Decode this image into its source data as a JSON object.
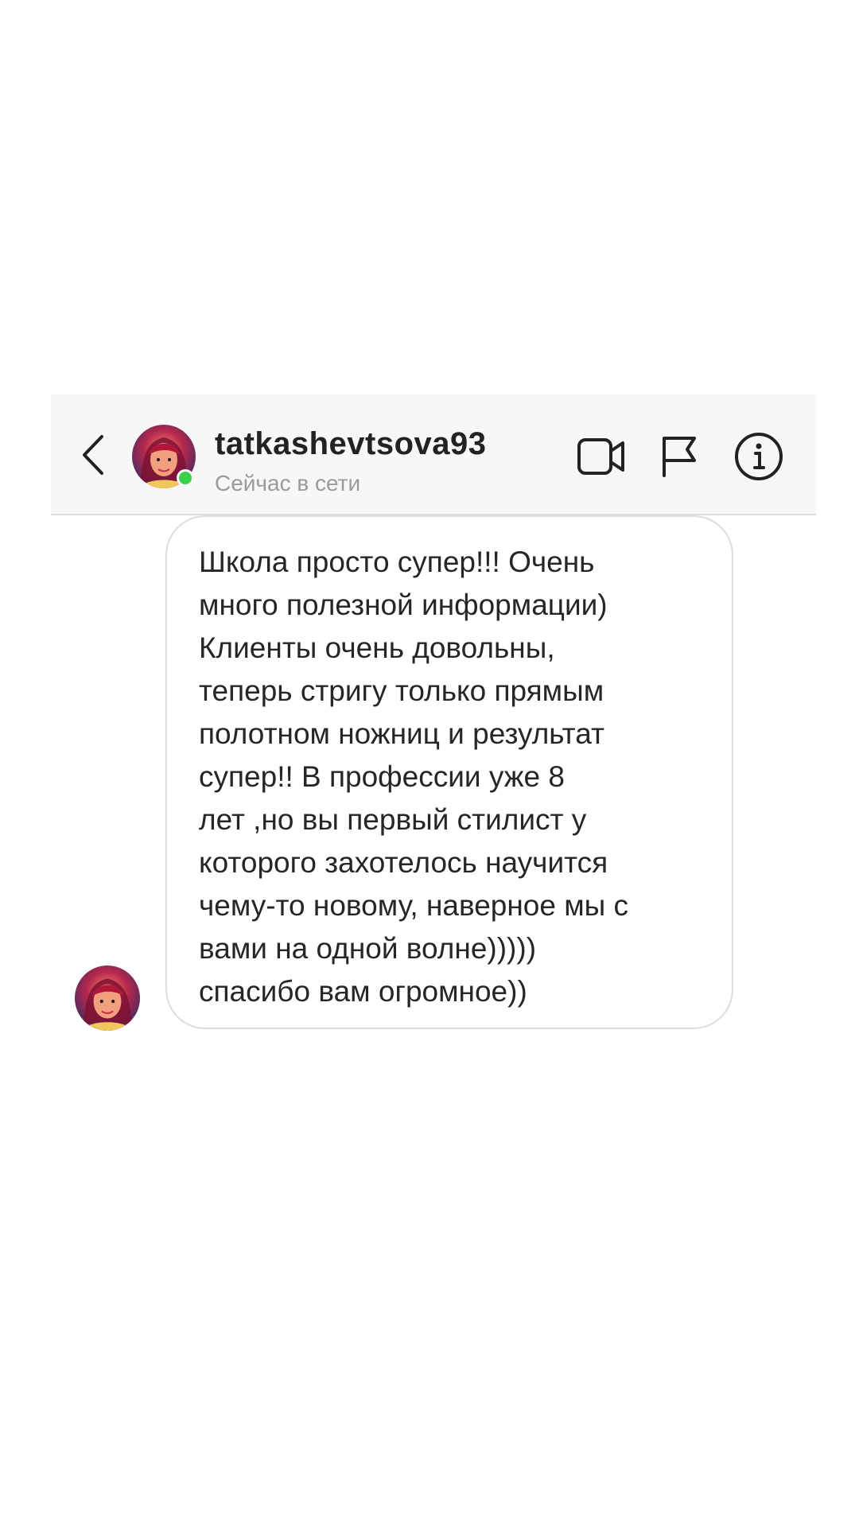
{
  "header": {
    "username": "tatkashevtsova93",
    "status": "Сейчас в сети",
    "icons": {
      "back": "chevron-left-icon",
      "video": "video-camera-icon",
      "flag": "flag-icon",
      "info": "info-icon"
    },
    "online_color": "#39d14a"
  },
  "message": {
    "text": "Школа просто супер!!! Очень\nмного полезной информации)\nКлиенты очень довольны,\nтеперь стригу только прямым\nполотном ножниц и результат\nсупер!! В профессии уже 8\nлет ,но вы первый стилист у\nкоторого захотелось научится\nчему-то новому, наверное мы с\nвами на одной волне)))))\nспасибо вам огромное))"
  }
}
